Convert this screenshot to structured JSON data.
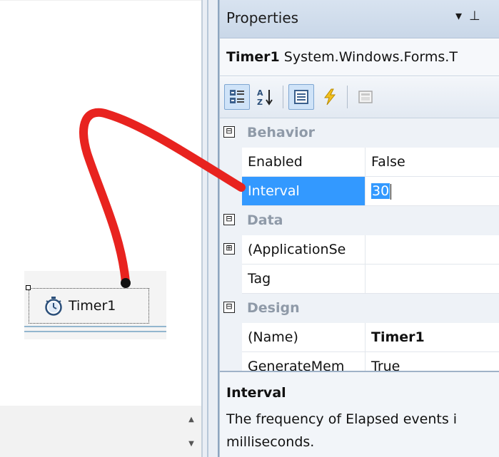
{
  "designer": {
    "component_label": "Timer1",
    "component_icon": "stopwatch-icon"
  },
  "properties": {
    "title": "Properties",
    "title_buttons": [
      "dropdown-arrow-icon",
      "pin-icon"
    ],
    "object_name": "Timer1",
    "object_type": "System.Windows.Forms.T",
    "toolbar": [
      "categorized-icon",
      "alphabetical-icon",
      "properties-icon",
      "events-icon",
      "property-pages-icon"
    ],
    "grid": [
      {
        "kind": "category",
        "label": "Behavior",
        "toggle": "⊟"
      },
      {
        "kind": "property",
        "name": "Enabled",
        "value": "False"
      },
      {
        "kind": "property",
        "name": "Interval",
        "value": "30",
        "selected": true
      },
      {
        "kind": "category",
        "label": "Data",
        "toggle": "⊟"
      },
      {
        "kind": "property",
        "name": "(ApplicationSe",
        "value": "",
        "toggle": "⊞"
      },
      {
        "kind": "property",
        "name": "Tag",
        "value": ""
      },
      {
        "kind": "category",
        "label": "Design",
        "toggle": "⊟"
      },
      {
        "kind": "property",
        "name": "(Name)",
        "value": "Timer1",
        "bold_value": true
      },
      {
        "kind": "property",
        "name": "GenerateMem",
        "value": "True"
      }
    ],
    "description": {
      "title": "Interval",
      "line1": "The frequency of Elapsed events i",
      "line2": "milliseconds."
    }
  },
  "colors": {
    "selection": "#3399ff",
    "annotation_stroke": "#e8231f",
    "header_bg": "#d3dfee",
    "category_text": "#8f9aa8"
  }
}
